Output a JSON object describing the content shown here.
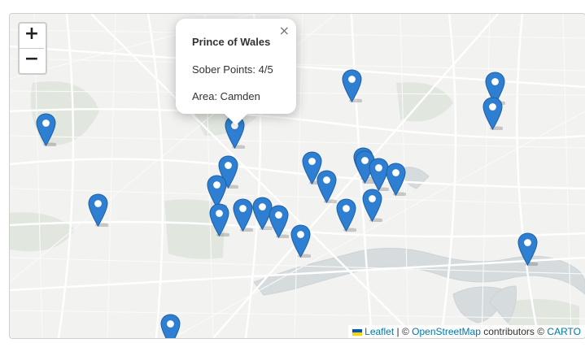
{
  "zoom": {
    "in_label": "+",
    "out_label": "−"
  },
  "popup": {
    "title": "Prince of Wales",
    "line1": "Sober Points: 4/5",
    "line2": "Area: Camden",
    "close_label": "×"
  },
  "attribution": {
    "leaflet": "Leaflet",
    "separator": " | © ",
    "osm": "OpenStreetMap",
    "contributors": " contributors © ",
    "carto": "CARTO"
  },
  "colors": {
    "marker": "#2e7fd1",
    "water": "#d4dadc",
    "park": "#dfe5dc",
    "link": "#0078a8"
  },
  "icons": {
    "marker": "map-pin-icon",
    "flag": "ukraine-flag-icon"
  }
}
